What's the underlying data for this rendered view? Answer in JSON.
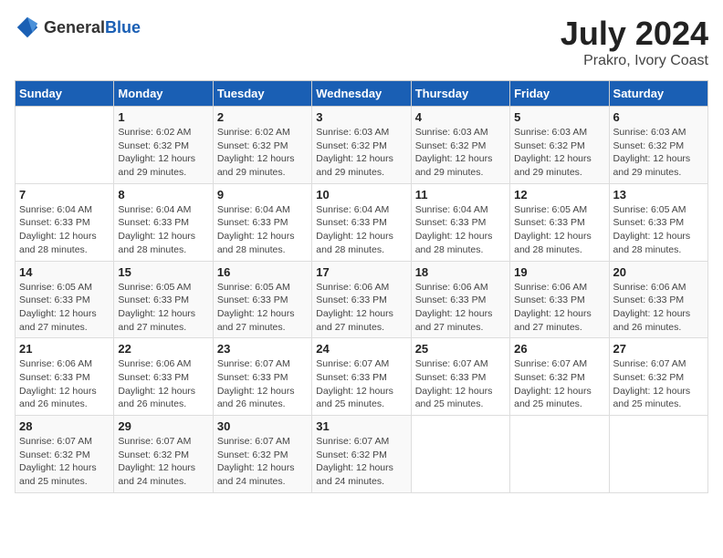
{
  "header": {
    "logo_general": "General",
    "logo_blue": "Blue",
    "title": "July 2024",
    "subtitle": "Prakro, Ivory Coast"
  },
  "weekdays": [
    "Sunday",
    "Monday",
    "Tuesday",
    "Wednesday",
    "Thursday",
    "Friday",
    "Saturday"
  ],
  "weeks": [
    [
      {
        "day": "",
        "info": ""
      },
      {
        "day": "1",
        "info": "Sunrise: 6:02 AM\nSunset: 6:32 PM\nDaylight: 12 hours\nand 29 minutes."
      },
      {
        "day": "2",
        "info": "Sunrise: 6:02 AM\nSunset: 6:32 PM\nDaylight: 12 hours\nand 29 minutes."
      },
      {
        "day": "3",
        "info": "Sunrise: 6:03 AM\nSunset: 6:32 PM\nDaylight: 12 hours\nand 29 minutes."
      },
      {
        "day": "4",
        "info": "Sunrise: 6:03 AM\nSunset: 6:32 PM\nDaylight: 12 hours\nand 29 minutes."
      },
      {
        "day": "5",
        "info": "Sunrise: 6:03 AM\nSunset: 6:32 PM\nDaylight: 12 hours\nand 29 minutes."
      },
      {
        "day": "6",
        "info": "Sunrise: 6:03 AM\nSunset: 6:32 PM\nDaylight: 12 hours\nand 29 minutes."
      }
    ],
    [
      {
        "day": "7",
        "info": "Sunrise: 6:04 AM\nSunset: 6:33 PM\nDaylight: 12 hours\nand 28 minutes."
      },
      {
        "day": "8",
        "info": "Sunrise: 6:04 AM\nSunset: 6:33 PM\nDaylight: 12 hours\nand 28 minutes."
      },
      {
        "day": "9",
        "info": "Sunrise: 6:04 AM\nSunset: 6:33 PM\nDaylight: 12 hours\nand 28 minutes."
      },
      {
        "day": "10",
        "info": "Sunrise: 6:04 AM\nSunset: 6:33 PM\nDaylight: 12 hours\nand 28 minutes."
      },
      {
        "day": "11",
        "info": "Sunrise: 6:04 AM\nSunset: 6:33 PM\nDaylight: 12 hours\nand 28 minutes."
      },
      {
        "day": "12",
        "info": "Sunrise: 6:05 AM\nSunset: 6:33 PM\nDaylight: 12 hours\nand 28 minutes."
      },
      {
        "day": "13",
        "info": "Sunrise: 6:05 AM\nSunset: 6:33 PM\nDaylight: 12 hours\nand 28 minutes."
      }
    ],
    [
      {
        "day": "14",
        "info": "Sunrise: 6:05 AM\nSunset: 6:33 PM\nDaylight: 12 hours\nand 27 minutes."
      },
      {
        "day": "15",
        "info": "Sunrise: 6:05 AM\nSunset: 6:33 PM\nDaylight: 12 hours\nand 27 minutes."
      },
      {
        "day": "16",
        "info": "Sunrise: 6:05 AM\nSunset: 6:33 PM\nDaylight: 12 hours\nand 27 minutes."
      },
      {
        "day": "17",
        "info": "Sunrise: 6:06 AM\nSunset: 6:33 PM\nDaylight: 12 hours\nand 27 minutes."
      },
      {
        "day": "18",
        "info": "Sunrise: 6:06 AM\nSunset: 6:33 PM\nDaylight: 12 hours\nand 27 minutes."
      },
      {
        "day": "19",
        "info": "Sunrise: 6:06 AM\nSunset: 6:33 PM\nDaylight: 12 hours\nand 27 minutes."
      },
      {
        "day": "20",
        "info": "Sunrise: 6:06 AM\nSunset: 6:33 PM\nDaylight: 12 hours\nand 26 minutes."
      }
    ],
    [
      {
        "day": "21",
        "info": "Sunrise: 6:06 AM\nSunset: 6:33 PM\nDaylight: 12 hours\nand 26 minutes."
      },
      {
        "day": "22",
        "info": "Sunrise: 6:06 AM\nSunset: 6:33 PM\nDaylight: 12 hours\nand 26 minutes."
      },
      {
        "day": "23",
        "info": "Sunrise: 6:07 AM\nSunset: 6:33 PM\nDaylight: 12 hours\nand 26 minutes."
      },
      {
        "day": "24",
        "info": "Sunrise: 6:07 AM\nSunset: 6:33 PM\nDaylight: 12 hours\nand 25 minutes."
      },
      {
        "day": "25",
        "info": "Sunrise: 6:07 AM\nSunset: 6:33 PM\nDaylight: 12 hours\nand 25 minutes."
      },
      {
        "day": "26",
        "info": "Sunrise: 6:07 AM\nSunset: 6:32 PM\nDaylight: 12 hours\nand 25 minutes."
      },
      {
        "day": "27",
        "info": "Sunrise: 6:07 AM\nSunset: 6:32 PM\nDaylight: 12 hours\nand 25 minutes."
      }
    ],
    [
      {
        "day": "28",
        "info": "Sunrise: 6:07 AM\nSunset: 6:32 PM\nDaylight: 12 hours\nand 25 minutes."
      },
      {
        "day": "29",
        "info": "Sunrise: 6:07 AM\nSunset: 6:32 PM\nDaylight: 12 hours\nand 24 minutes."
      },
      {
        "day": "30",
        "info": "Sunrise: 6:07 AM\nSunset: 6:32 PM\nDaylight: 12 hours\nand 24 minutes."
      },
      {
        "day": "31",
        "info": "Sunrise: 6:07 AM\nSunset: 6:32 PM\nDaylight: 12 hours\nand 24 minutes."
      },
      {
        "day": "",
        "info": ""
      },
      {
        "day": "",
        "info": ""
      },
      {
        "day": "",
        "info": ""
      }
    ]
  ]
}
